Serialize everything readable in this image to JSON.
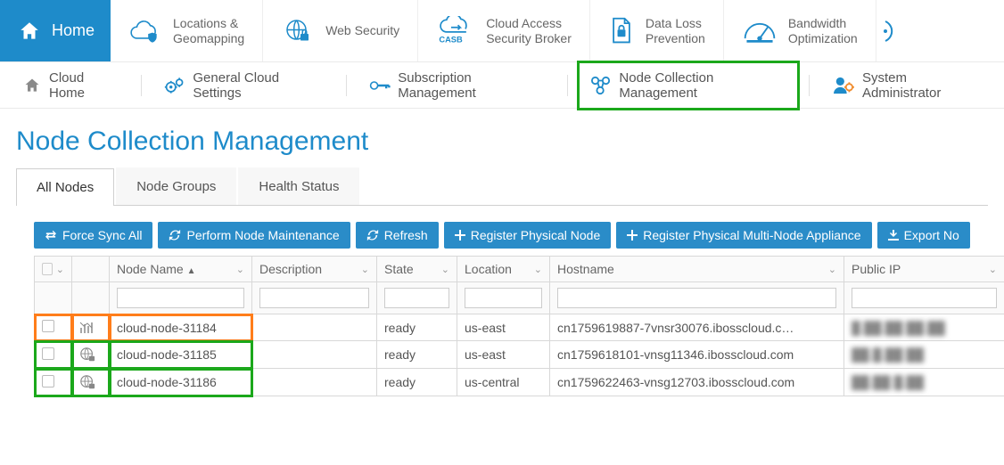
{
  "topnav": {
    "home": "Home",
    "items": [
      {
        "label": "Locations &\nGeomapping"
      },
      {
        "label": "Web Security"
      },
      {
        "label": "Cloud Access\nSecurity Broker"
      },
      {
        "label": "Data Loss\nPrevention"
      },
      {
        "label": "Bandwidth\nOptimization"
      }
    ]
  },
  "subnav": {
    "items": [
      {
        "label": "Cloud Home"
      },
      {
        "label": "General Cloud Settings"
      },
      {
        "label": "Subscription Management"
      },
      {
        "label": "Node Collection Management",
        "active": true
      },
      {
        "label": "System Administrator"
      }
    ]
  },
  "page": {
    "title": "Node Collection Management"
  },
  "tabs": [
    {
      "label": "All Nodes",
      "active": true
    },
    {
      "label": "Node Groups"
    },
    {
      "label": "Health Status"
    }
  ],
  "toolbar": {
    "force_sync": "Force Sync All",
    "maintenance": "Perform Node Maintenance",
    "refresh": "Refresh",
    "register_node": "Register Physical Node",
    "register_multi": "Register Physical Multi-Node Appliance",
    "export": "Export No"
  },
  "columns": {
    "node_name": "Node Name",
    "description": "Description",
    "state": "State",
    "location": "Location",
    "hostname": "Hostname",
    "public_ip": "Public IP"
  },
  "rows": [
    {
      "name": "cloud-node-31184",
      "state": "ready",
      "location": "us-east",
      "hostname": "cn1759619887-7vnsr30076.ibosscloud.c…",
      "public_ip": "█.██.██  ██.██",
      "icon": "stats",
      "highlight": "orange"
    },
    {
      "name": "cloud-node-31185",
      "state": "ready",
      "location": "us-east",
      "hostname": "cn1759618101-vnsg11346.ibosscloud.com",
      "public_ip": "██.█.██  ██",
      "icon": "globe",
      "highlight": "green"
    },
    {
      "name": "cloud-node-31186",
      "state": "ready",
      "location": "us-central",
      "hostname": "cn1759622463-vnsg12703.ibosscloud.com",
      "public_ip": "██.██  █.██",
      "icon": "globe",
      "highlight": "green"
    }
  ]
}
